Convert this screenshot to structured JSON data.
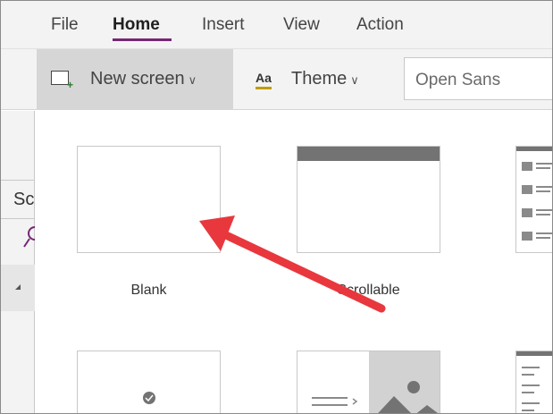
{
  "menubar": {
    "items": [
      {
        "label": "File",
        "active": false
      },
      {
        "label": "Home",
        "active": true
      },
      {
        "label": "Insert",
        "active": false
      },
      {
        "label": "View",
        "active": false
      },
      {
        "label": "Action",
        "active": false
      }
    ],
    "accent_color": "#742774"
  },
  "ribbon": {
    "new_screen_label": "New screen",
    "theme_label": "Theme",
    "theme_icon_glyph": "Aa",
    "font_value": "Open Sans",
    "chevron_glyph": "∨"
  },
  "left_pane": {
    "partial_text": "Sc"
  },
  "gallery": {
    "layouts": [
      {
        "label": "Blank",
        "icon": "blank-layout-thumbnail"
      },
      {
        "label": "Scrollable",
        "icon": "scrollable-layout-thumbnail"
      },
      {
        "label": "",
        "icon": "list-layout-thumbnail"
      },
      {
        "label": "",
        "icon": "form-layout-thumbnail"
      },
      {
        "label": "",
        "icon": "split-image-layout-thumbnail"
      },
      {
        "label": "",
        "icon": "list-layout-thumbnail-2"
      }
    ]
  },
  "annotation": {
    "arrow_color": "#e8383d",
    "arrow_points_to": "Blank"
  }
}
